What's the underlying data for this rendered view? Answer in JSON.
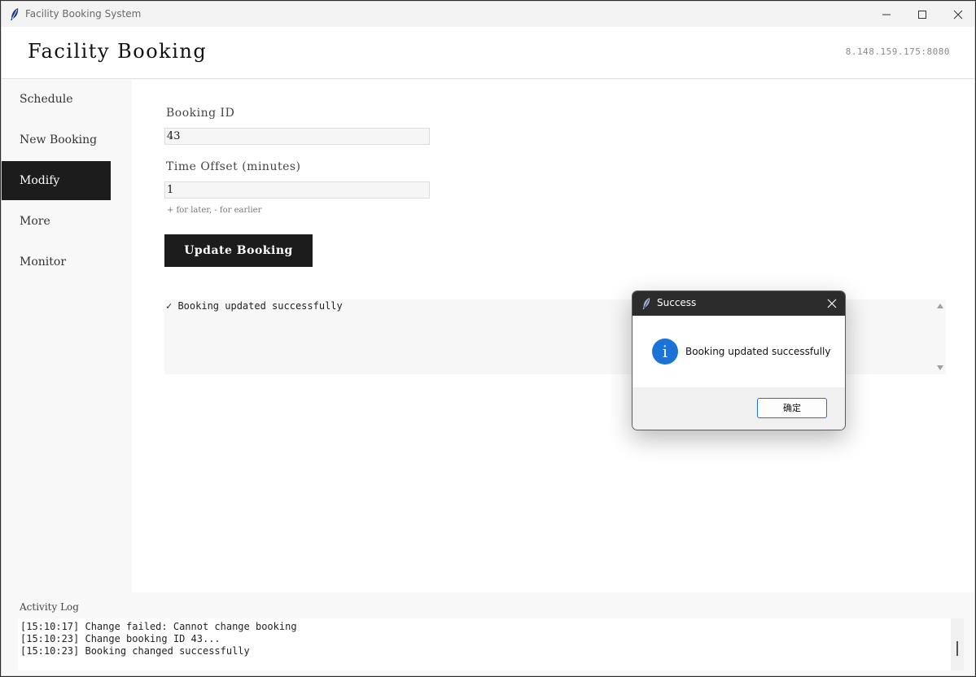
{
  "window": {
    "title": "Facility Booking System"
  },
  "header": {
    "title": "Facility Booking",
    "server": "8.148.159.175:8080"
  },
  "sidebar": {
    "items": [
      {
        "label": "Schedule",
        "active": false
      },
      {
        "label": "New Booking",
        "active": false
      },
      {
        "label": "Modify",
        "active": true
      },
      {
        "label": "More",
        "active": false
      },
      {
        "label": "Monitor",
        "active": false
      }
    ]
  },
  "form": {
    "booking_id_label": "Booking ID",
    "booking_id_value": "43",
    "offset_label": "Time Offset (minutes)",
    "offset_value": "1",
    "offset_hint": "+ for later, - for earlier",
    "submit_label": "Update Booking"
  },
  "result": {
    "text": "✓ Booking updated successfully"
  },
  "log": {
    "title": "Activity Log",
    "lines": [
      "[15:10:17] Change failed: Cannot change booking",
      "[15:10:23] Change booking ID 43...",
      "[15:10:23] Booking changed successfully"
    ]
  },
  "dialog": {
    "title": "Success",
    "message": "Booking updated successfully",
    "ok_label": "确定",
    "icon": "info-icon"
  },
  "colors": {
    "accent_dark": "#1c1c1c",
    "info_blue": "#1a73d6",
    "dialog_titlebar": "#2c2c2c"
  }
}
